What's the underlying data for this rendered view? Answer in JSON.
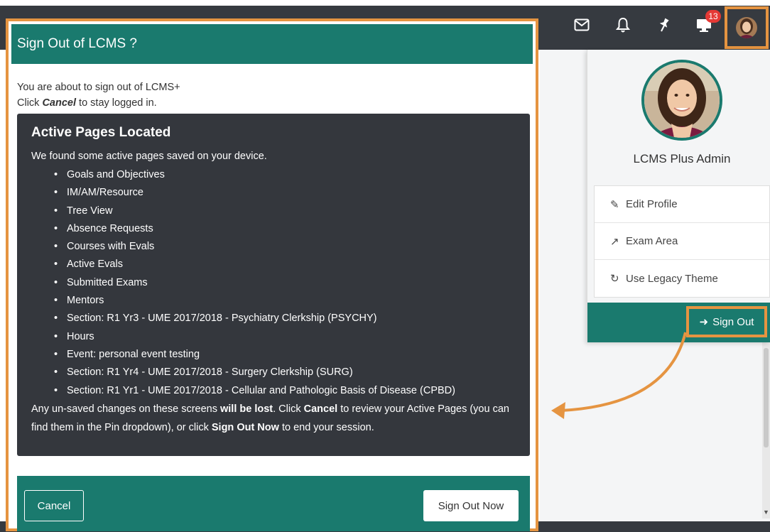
{
  "nav": {
    "icons": [
      "envelope-icon",
      "bell-icon",
      "pin-icon",
      "monitor-icon"
    ],
    "notification_count": "13"
  },
  "modal": {
    "title": "Sign Out of LCMS ?",
    "intro_line1": "You are about to sign out of LCMS+",
    "intro_line2_pre": "Click ",
    "intro_line2_em": "Cancel",
    "intro_line2_post": " to stay logged in.",
    "panel": {
      "heading": "Active Pages Located",
      "lead": "We found some active pages saved on your device.",
      "pages": [
        "Goals and Objectives",
        "IM/AM/Resource",
        "Tree View",
        "Absence Requests",
        "Courses with Evals",
        "Active Evals",
        "Submitted Exams",
        "Mentors",
        "Section: R1 Yr3 - UME 2017/2018 - Psychiatry Clerkship (PSYCHY)",
        "Hours",
        "Event: personal event testing",
        "Section: R1 Yr4 - UME 2017/2018 - Surgery Clerkship (SURG)",
        "Section: R1 Yr1 - UME 2017/2018 - Cellular and Pathologic Basis of Disease (CPBD)"
      ],
      "warning_1": "Any un-saved changes on these screens ",
      "warning_bold_1": "will be lost",
      "warning_2": ". Click ",
      "warning_bold_2": "Cancel",
      "warning_3": " to review your Active Pages (you can find them in the Pin dropdown), or click ",
      "warning_bold_3": "Sign Out Now",
      "warning_4": " to end your session."
    },
    "cancel_label": "Cancel",
    "signout_now_label": "Sign Out Now"
  },
  "profile": {
    "name": "LCMS Plus Admin",
    "menu": [
      {
        "icon": "edit-icon",
        "label": "Edit Profile"
      },
      {
        "icon": "external-link-icon",
        "label": "Exam Area"
      },
      {
        "icon": "refresh-icon",
        "label": "Use Legacy Theme"
      }
    ],
    "signout_label": "Sign Out",
    "signout_icon": "sign-out-icon"
  },
  "colors": {
    "teal": "#1a7a6e",
    "highlight": "#e59441",
    "dark_panel": "#34373d",
    "topbar": "#363a40"
  }
}
